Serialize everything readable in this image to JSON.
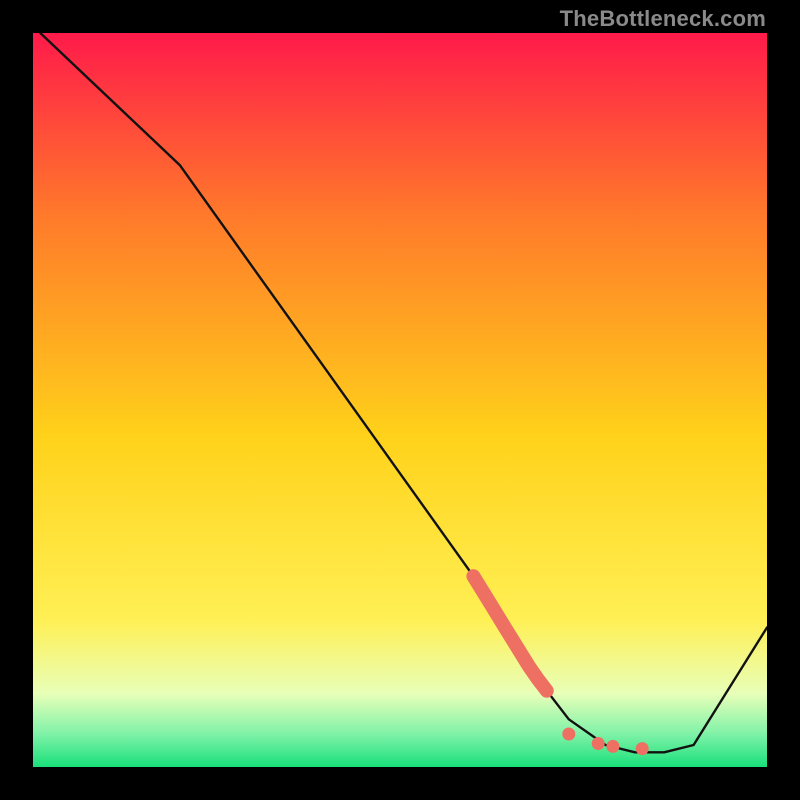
{
  "watermark": "TheBottleneck.com",
  "colors": {
    "top": "#ff1a4a",
    "mid_upper": "#ff7a2a",
    "mid": "#ffd21a",
    "mid_lower": "#fff055",
    "band_pale": "#e8ffb8",
    "green": "#19e07a",
    "curve_stroke": "#121212",
    "marker": "#ed7063",
    "frame": "#000000"
  },
  "chart_data": {
    "type": "line",
    "title": "",
    "xlabel": "",
    "ylabel": "",
    "xlim": [
      0,
      100
    ],
    "ylim": [
      0,
      100
    ],
    "series": [
      {
        "name": "bottleneck-curve",
        "x": [
          1,
          20,
          30,
          40,
          50,
          60,
          68,
          73,
          78,
          82,
          86,
          90,
          100
        ],
        "y": [
          100,
          82,
          68,
          54,
          40,
          26,
          13,
          6.5,
          3,
          2,
          2,
          3,
          19
        ]
      }
    ],
    "highlight_segment": {
      "series": "bottleneck-curve",
      "x_range": [
        60,
        70
      ],
      "style": "thick-rounded"
    },
    "markers": [
      {
        "x": 73,
        "y": 4.5
      },
      {
        "x": 77,
        "y": 3.2
      },
      {
        "x": 79,
        "y": 2.8
      },
      {
        "x": 83,
        "y": 2.5
      }
    ],
    "gradient_stops": [
      {
        "offset": 0.0,
        "color": "#ff1a4a"
      },
      {
        "offset": 0.25,
        "color": "#ff7a2a"
      },
      {
        "offset": 0.55,
        "color": "#ffd21a"
      },
      {
        "offset": 0.8,
        "color": "#fff055"
      },
      {
        "offset": 0.9,
        "color": "#e8ffb8"
      },
      {
        "offset": 0.955,
        "color": "#7ff2a8"
      },
      {
        "offset": 1.0,
        "color": "#19e07a"
      }
    ]
  }
}
